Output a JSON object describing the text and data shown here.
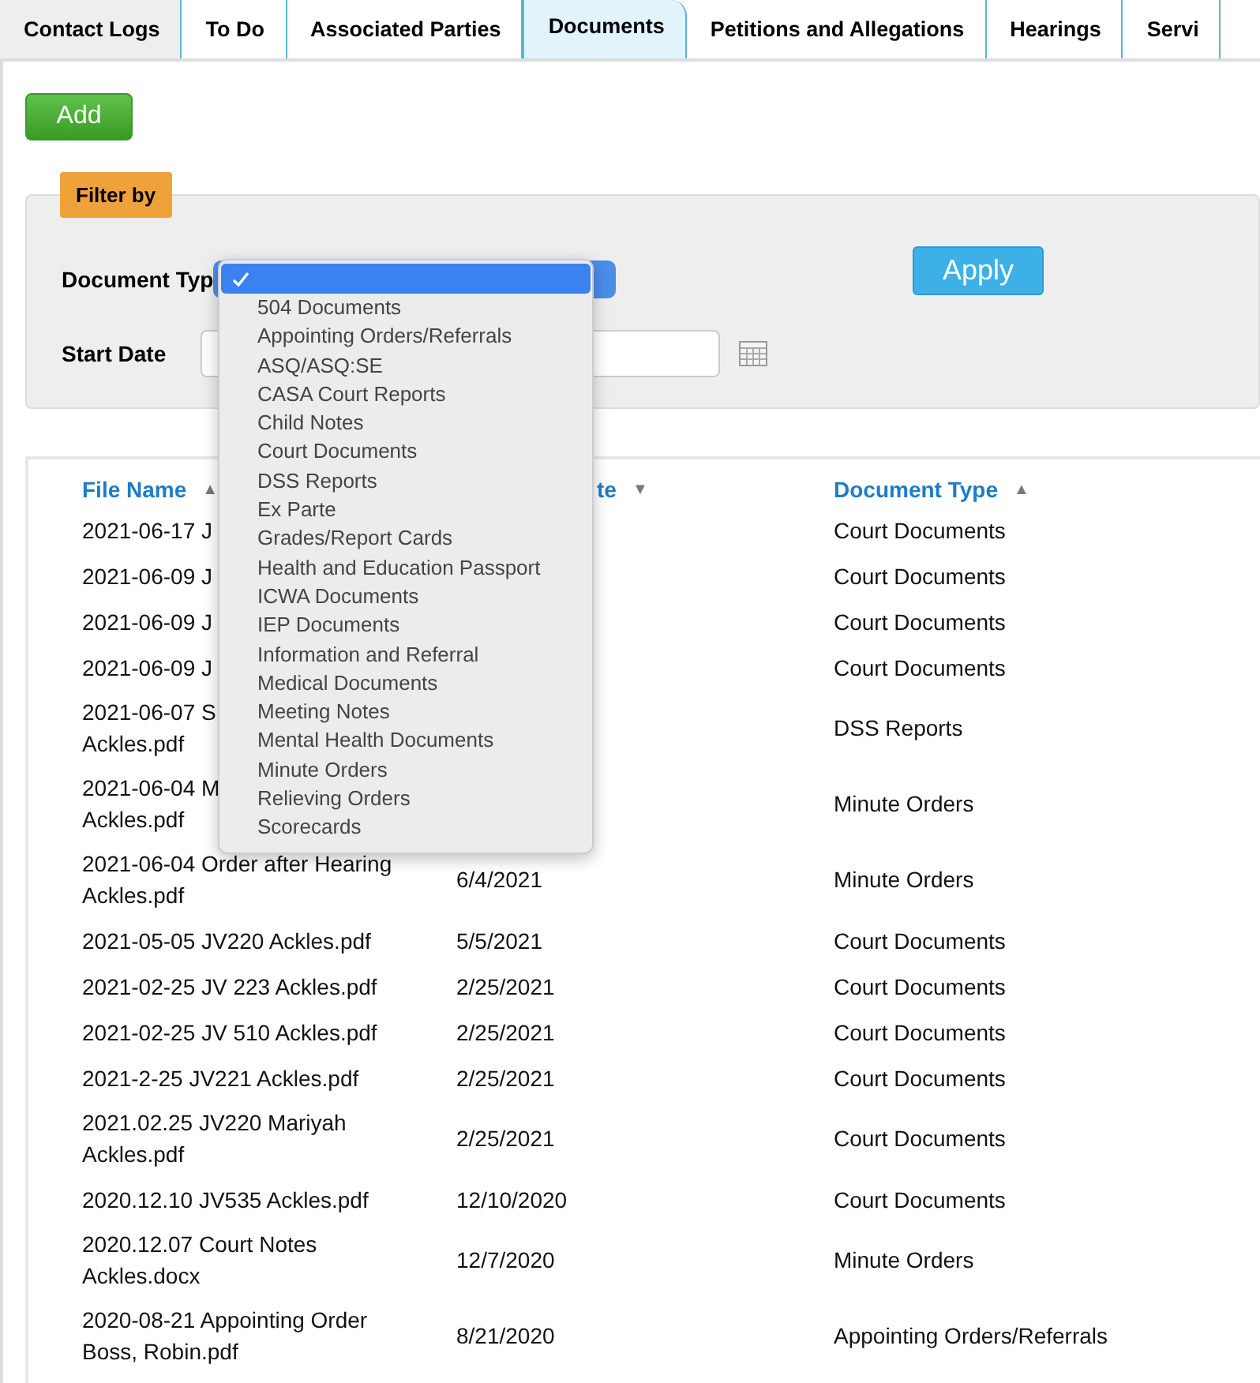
{
  "tabs": [
    {
      "label": "Contact Logs",
      "selected": false
    },
    {
      "label": "To Do",
      "selected": false
    },
    {
      "label": "Associated Parties",
      "selected": false
    },
    {
      "label": "Documents",
      "selected": true
    },
    {
      "label": "Petitions and Allegations",
      "selected": false
    },
    {
      "label": "Hearings",
      "selected": false
    },
    {
      "label": "Servi",
      "selected": false
    }
  ],
  "add_button": "Add",
  "filter": {
    "title": "Filter by",
    "document_type_label": "Document Typ",
    "start_date_label": "Start Date",
    "apply_button": "Apply",
    "dropdown": {
      "blank_option": {
        "selected": true
      },
      "options": [
        {
          "label": "504 Documents",
          "selected": false
        },
        {
          "label": "Appointing Orders/Referrals",
          "selected": false
        },
        {
          "label": "ASQ/ASQ:SE",
          "selected": false
        },
        {
          "label": "CASA Court Reports",
          "selected": false
        },
        {
          "label": "Child Notes",
          "selected": false
        },
        {
          "label": "Court Documents",
          "selected": false
        },
        {
          "label": "DSS Reports",
          "selected": false
        },
        {
          "label": "Ex Parte",
          "selected": false
        },
        {
          "label": "Grades/Report Cards",
          "selected": false
        },
        {
          "label": "Health and Education Passport",
          "selected": false
        },
        {
          "label": "ICWA Documents",
          "selected": false
        },
        {
          "label": "IEP Documents",
          "selected": false
        },
        {
          "label": "Information and Referral",
          "selected": false
        },
        {
          "label": "Medical Documents",
          "selected": false
        },
        {
          "label": "Meeting Notes",
          "selected": false
        },
        {
          "label": "Mental Health Documents",
          "selected": false
        },
        {
          "label": "Minute Orders",
          "selected": false
        },
        {
          "label": "Relieving Orders",
          "selected": false
        },
        {
          "label": "Scorecards",
          "selected": false
        }
      ]
    }
  },
  "table": {
    "columns": [
      {
        "label": "File Name",
        "sort": "▲"
      },
      {
        "label": "te",
        "sort": "▼"
      },
      {
        "label": "Document Type",
        "sort": "▲"
      }
    ],
    "rows": [
      {
        "file_name": "2021-06-17 J",
        "document_type": "Court Documents"
      },
      {
        "file_name": "2021-06-09 J",
        "document_type": "Court Documents"
      },
      {
        "file_name": "2021-06-09 J",
        "document_type": "Court Documents"
      },
      {
        "file_name": "2021-06-09 J",
        "document_type": "Court Documents"
      },
      {
        "file_name": "2021-06-07 S\nAckles.pdf",
        "document_type": "DSS Reports"
      },
      {
        "file_name": "2021-06-04 M\nAckles.pdf",
        "document_type": "Minute Orders"
      },
      {
        "file_name": "2021-06-04 Order after Hearing\nAckles.pdf",
        "date": "6/4/2021",
        "document_type": "Minute Orders"
      },
      {
        "file_name": "2021-05-05 JV220 Ackles.pdf",
        "date": "5/5/2021",
        "document_type": "Court Documents"
      },
      {
        "file_name": "2021-02-25 JV 223 Ackles.pdf",
        "date": "2/25/2021",
        "document_type": "Court Documents"
      },
      {
        "file_name": "2021-02-25 JV 510 Ackles.pdf",
        "date": "2/25/2021",
        "document_type": "Court Documents"
      },
      {
        "file_name": "2021-2-25 JV221 Ackles.pdf",
        "date": "2/25/2021",
        "document_type": "Court Documents"
      },
      {
        "file_name": "2021.02.25 JV220 Mariyah\nAckles.pdf",
        "date": "2/25/2021",
        "document_type": "Court Documents"
      },
      {
        "file_name": "2020.12.10 JV535 Ackles.pdf",
        "date": "12/10/2020",
        "document_type": "Court Documents"
      },
      {
        "file_name": "2020.12.07 Court Notes\nAckles.docx",
        "date": "12/7/2020",
        "document_type": "Minute Orders"
      },
      {
        "file_name": "2020-08-21 Appointing Order\nBoss, Robin.pdf",
        "date": "8/21/2020",
        "document_type": "Appointing Orders/Referrals"
      }
    ]
  }
}
